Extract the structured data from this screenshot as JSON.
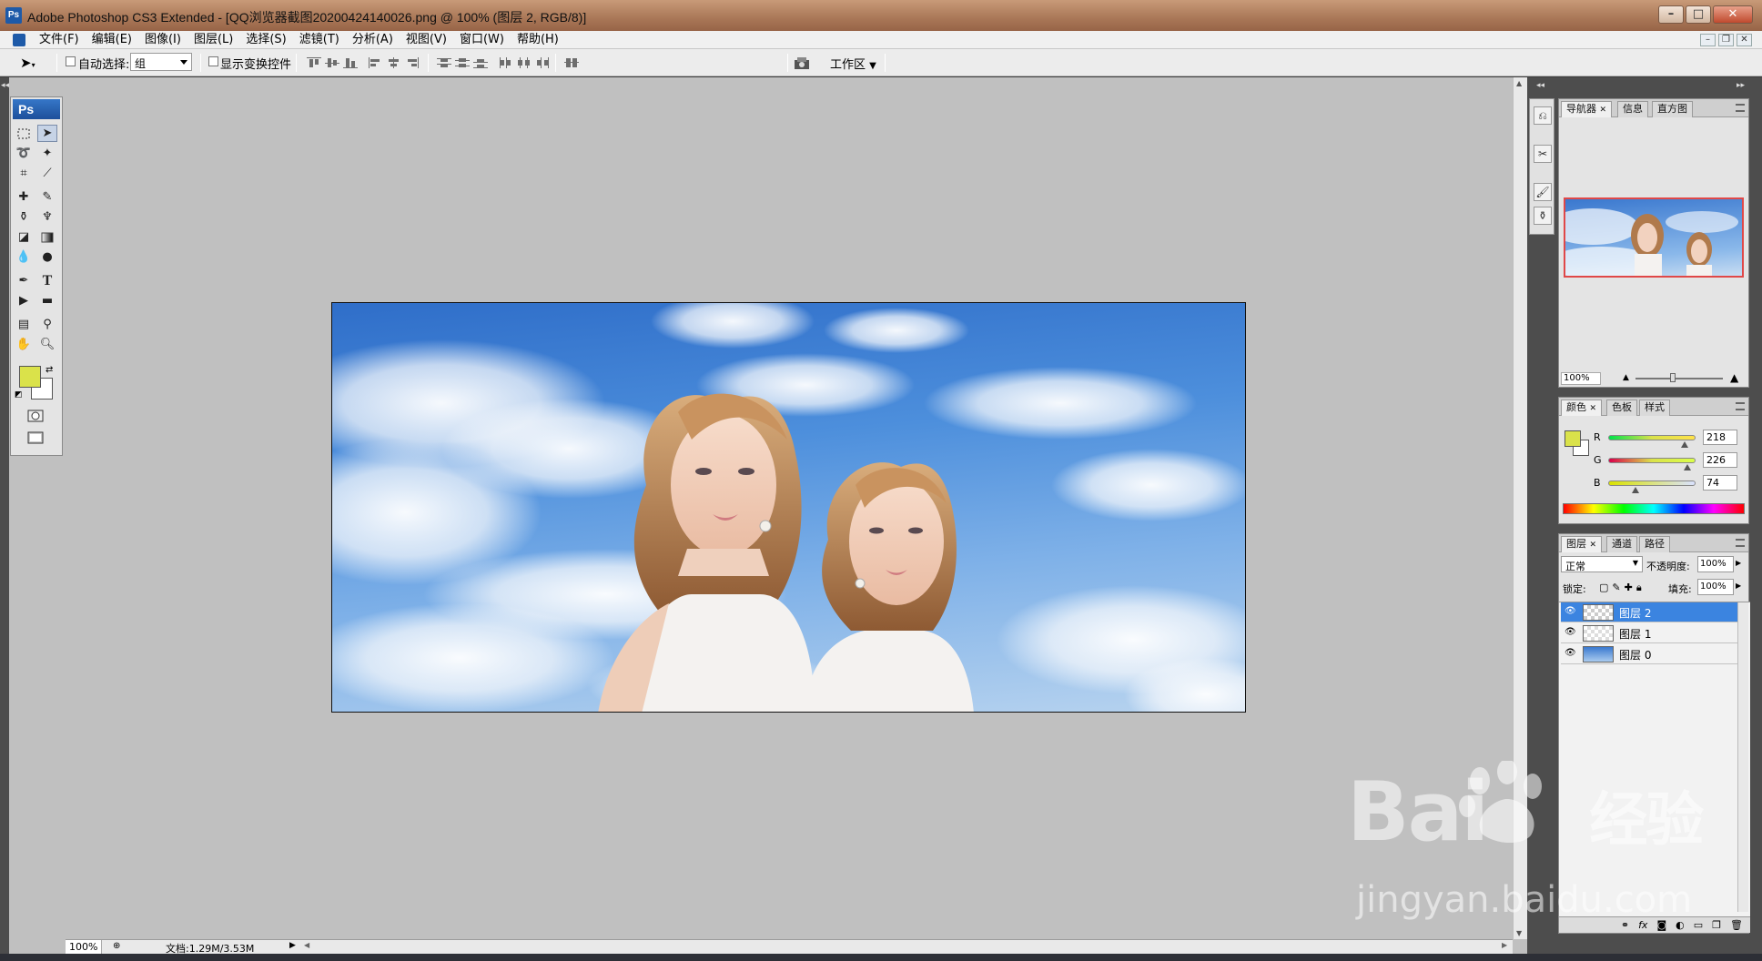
{
  "window": {
    "title": "Adobe Photoshop CS3 Extended - [QQ浏览器截图20200424140026.png @ 100% (图层 2, RGB/8)]",
    "app_icon": "Ps",
    "minimize": "–",
    "maximize": "□",
    "close": "✕"
  },
  "menu": [
    "文件(F)",
    "编辑(E)",
    "图像(I)",
    "图层(L)",
    "选择(S)",
    "滤镜(T)",
    "分析(A)",
    "视图(V)",
    "窗口(W)",
    "帮助(H)"
  ],
  "options_bar": {
    "auto_select_label": "自动选择:",
    "auto_select_value": "组",
    "show_transform_label": "显示变换控件",
    "workspace_label": "工作区"
  },
  "toolbox": {
    "header": "Ps",
    "foreground_color": "#dae24a",
    "background_color": "#ffffff"
  },
  "status": {
    "zoom": "100%",
    "doc_info": "文档:1.29M/3.53M"
  },
  "navigator_panel": {
    "tabs": [
      "导航器",
      "信息",
      "直方图"
    ],
    "zoom": "100%"
  },
  "color_panel": {
    "tabs": [
      "颜色",
      "色板",
      "样式"
    ],
    "r_label": "R",
    "g_label": "G",
    "b_label": "B",
    "r": "218",
    "g": "226",
    "b": "74"
  },
  "layers_panel": {
    "tabs": [
      "图层",
      "通道",
      "路径"
    ],
    "blend_mode": "正常",
    "opacity_label": "不透明度:",
    "opacity": "100%",
    "lock_label": "锁定:",
    "fill_label": "填充:",
    "fill": "100%",
    "layers": [
      {
        "name": "图层 2",
        "selected": true
      },
      {
        "name": "图层 1",
        "selected": false
      },
      {
        "name": "图层 0",
        "selected": false
      }
    ]
  },
  "watermark": {
    "brand": "Bai",
    "brand_suffix": "经验",
    "url": "jingyan.baidu.com"
  }
}
